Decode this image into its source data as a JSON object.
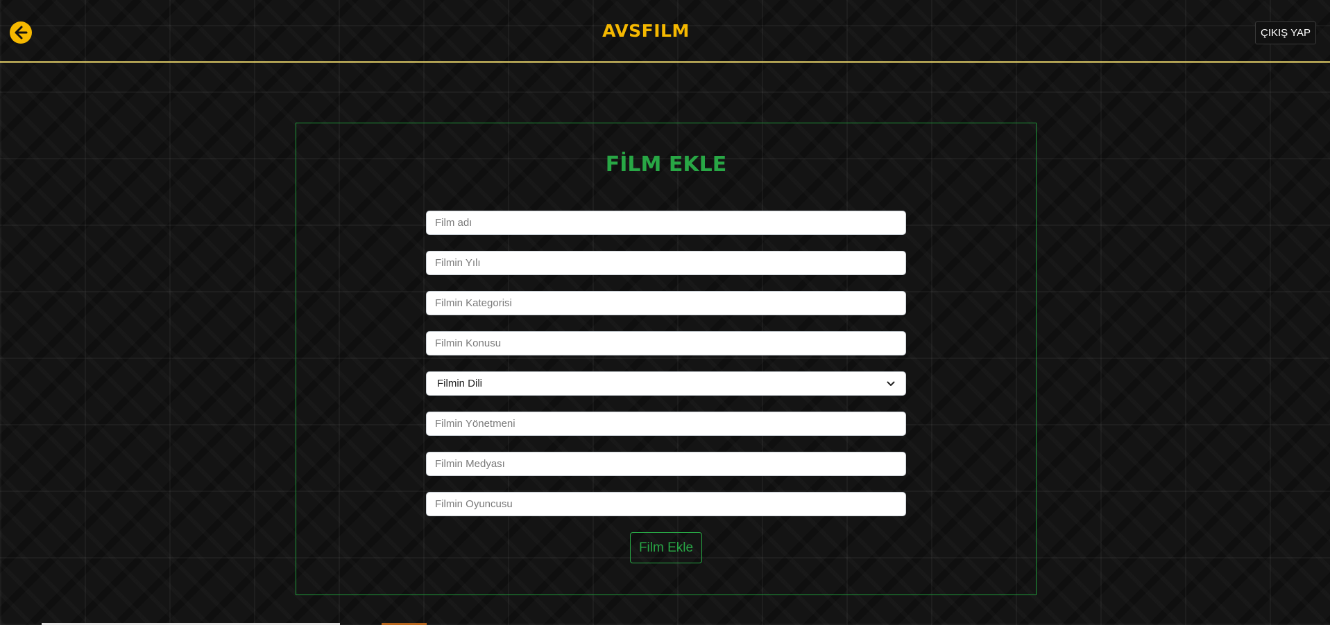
{
  "header": {
    "brand": "AVSFILM",
    "logout_label": "ÇIKIŞ YAP",
    "back_icon": "arrow-left-circle-icon",
    "accent_color": "#f5b800"
  },
  "form": {
    "title": "FİLM EKLE",
    "title_color": "#28a745",
    "fields": {
      "name_placeholder": "Film adı",
      "year_placeholder": "Filmin Yılı",
      "category_placeholder": "Filmin Kategorisi",
      "plot_placeholder": "Filmin Konusu",
      "language_selected": "Filmin Dili",
      "director_placeholder": "Filmin Yönetmeni",
      "media_placeholder": "Filmin Medyası",
      "actor_placeholder": "Filmin Oyuncusu"
    },
    "submit_label": "Film Ekle"
  }
}
